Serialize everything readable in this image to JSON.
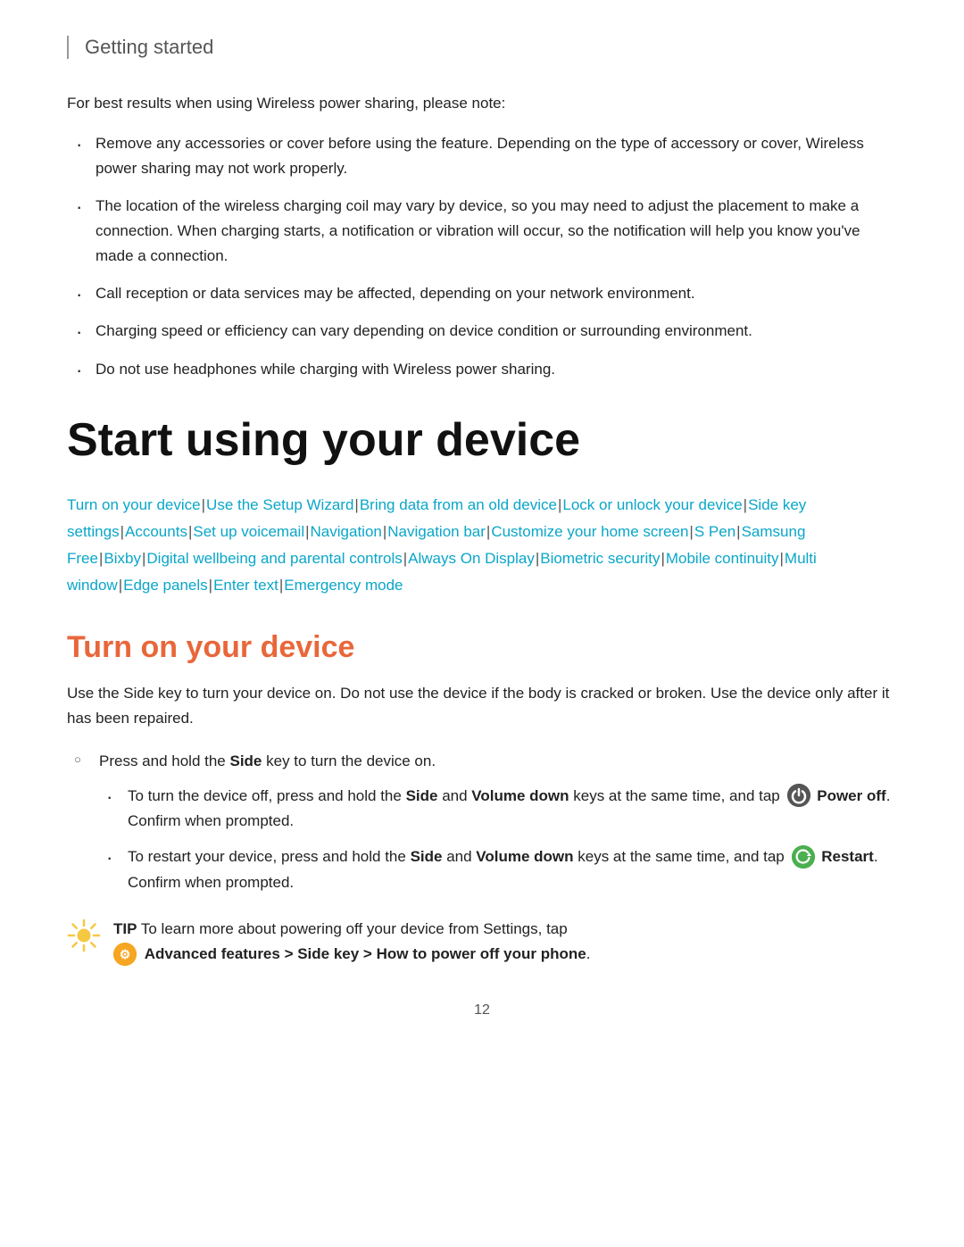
{
  "header": {
    "title": "Getting started"
  },
  "intro": {
    "text": "For best results when using Wireless power sharing, please note:"
  },
  "bullets": [
    "Remove any accessories or cover before using the feature. Depending on the type of accessory or cover, Wireless power sharing may not work properly.",
    "The location of the wireless charging coil may vary by device, so you may need to adjust the placement to make a connection. When charging starts, a notification or vibration will occur, so the notification will help you know you've made a connection.",
    "Call reception or data services may be affected, depending on your network environment.",
    "Charging speed or efficiency can vary depending on device condition or surrounding environment.",
    "Do not use headphones while charging with Wireless power sharing."
  ],
  "section_title": "Start using your device",
  "links": [
    "Turn on your device",
    "Use the Setup Wizard",
    "Bring data from an old device",
    "Lock or unlock your device",
    "Side key settings",
    "Accounts",
    "Set up voicemail",
    "Navigation",
    "Navigation bar",
    "Customize your home screen",
    "S Pen",
    "Samsung Free",
    "Bixby",
    "Digital wellbeing and parental controls",
    "Always On Display",
    "Biometric security",
    "Mobile continuity",
    "Multi window",
    "Edge panels",
    "Enter text",
    "Emergency mode"
  ],
  "subsection_title": "Turn on your device",
  "body_para": "Use the Side key to turn your device on. Do not use the device if the body is cracked or broken. Use the device only after it has been repaired.",
  "circle_bullet": "Press and hold the Side key to turn the device on.",
  "sub_bullets": [
    {
      "text_before": "To turn the device off, press and hold the ",
      "bold1": "Side",
      "text_mid1": " and ",
      "bold2": "Volume down",
      "text_mid2": " keys at the same time, and tap ",
      "icon": "power",
      "icon_label": "Power off",
      "text_end": ". Confirm when prompted."
    },
    {
      "text_before": "To restart your device, press and hold the ",
      "bold1": "Side",
      "text_mid1": " and ",
      "bold2": "Volume down",
      "text_mid2": " keys at the same time, and tap ",
      "icon": "restart",
      "icon_label": "Restart",
      "text_end": ". Confirm when prompted."
    }
  ],
  "tip": {
    "label": "TIP",
    "text_before": " To learn more about powering off your device from Settings, tap ",
    "bold_text": "Advanced features > Side key > How to power off your phone",
    "text_end": "."
  },
  "page_number": "12"
}
